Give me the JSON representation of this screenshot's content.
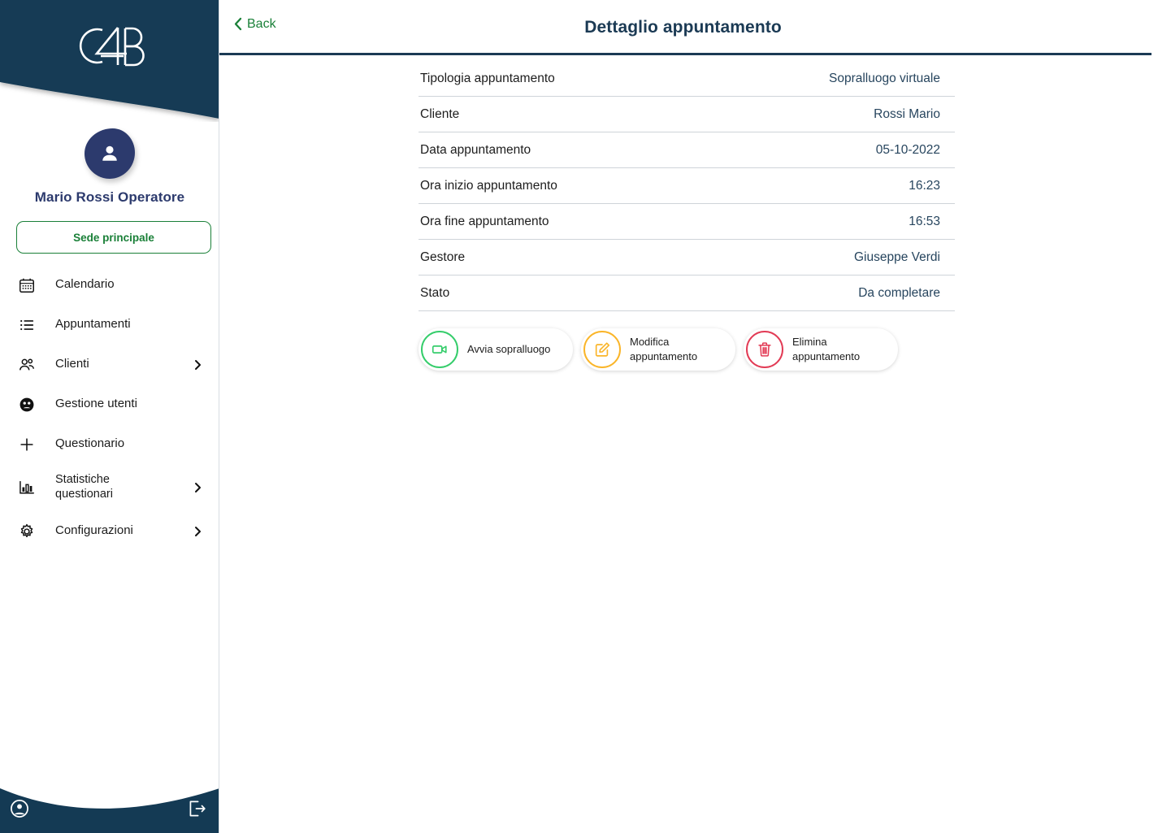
{
  "colors": {
    "navy": "#143a54",
    "avatar_blue": "#2c3a6d",
    "green": "#1a8038",
    "action_green": "#35cd6b",
    "action_amber": "#fab529",
    "action_red": "#e23b55",
    "value_text": "#27455e"
  },
  "sidebar": {
    "logo_text": "C4B",
    "avatar_icon": "person-icon",
    "username": "Mario Rossi Operatore",
    "sede_button": "Sede principale",
    "items": [
      {
        "label": "Calendario",
        "icon": "calendar-icon",
        "chevron": false,
        "two_line": false
      },
      {
        "label": "Appuntamenti",
        "icon": "list-icon",
        "chevron": false,
        "two_line": false
      },
      {
        "label": "Clienti",
        "icon": "people-icon",
        "chevron": true,
        "two_line": false
      },
      {
        "label": "Gestione utenti",
        "icon": "user-admin-icon",
        "chevron": false,
        "two_line": false
      },
      {
        "label": "Questionario",
        "icon": "plus-icon",
        "chevron": false,
        "two_line": false
      },
      {
        "label": "Statistiche\nquestionari",
        "icon": "bar-chart-icon",
        "chevron": true,
        "two_line": true
      },
      {
        "label": "Configurazioni",
        "icon": "gear-icon",
        "chevron": true,
        "two_line": false
      }
    ],
    "footer": {
      "account_icon": "account-circle-icon",
      "logout_icon": "logout-icon"
    }
  },
  "header": {
    "back_label": "Back",
    "back_icon": "chevron-left-icon",
    "title": "Dettaglio appuntamento"
  },
  "detail": {
    "rows": [
      {
        "label": "Tipologia appuntamento",
        "value": "Sopralluogo virtuale"
      },
      {
        "label": "Cliente",
        "value": "Rossi Mario"
      },
      {
        "label": "Data appuntamento",
        "value": "05-10-2022"
      },
      {
        "label": "Ora inizio appuntamento",
        "value": "16:23"
      },
      {
        "label": "Ora fine appuntamento",
        "value": "16:53"
      },
      {
        "label": "Gestore",
        "value": "Giuseppe Verdi"
      },
      {
        "label": "Stato",
        "value": "Da completare"
      }
    ]
  },
  "actions": [
    {
      "label": "Avvia sopralluogo",
      "icon": "video-camera-icon",
      "color": "green"
    },
    {
      "label": "Modifica\nappuntamento",
      "icon": "edit-square-icon",
      "color": "amber"
    },
    {
      "label": "Elimina\nappuntamento",
      "icon": "trash-icon",
      "color": "red"
    }
  ]
}
